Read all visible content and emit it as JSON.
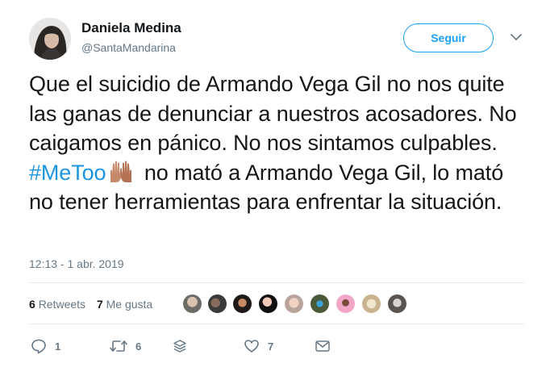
{
  "author": {
    "name": "Daniela Medina",
    "handle": "@SantaMandarina"
  },
  "follow_label": "Seguir",
  "tweet": {
    "part1": "Que el suicidio de Armando Vega Gil no nos quite las ganas de denunciar a nuestros acosadores. No caigamos en pánico. No nos sintamos culpables. ",
    "hashtag": "#MeToo",
    "emoji": "raised-hands-emoji",
    "part2": " no mató a Armando Vega Gil, lo mató no tener herramientas para enfrentar la situación."
  },
  "timestamp": "12:13 - 1 abr. 2019",
  "stats": {
    "retweets_count": "6",
    "retweets_label": "Retweets",
    "likes_count": "7",
    "likes_label": "Me gusta"
  },
  "likers_count": 9,
  "actions": {
    "reply_count": "1",
    "retweet_count": "6",
    "like_count": "7"
  },
  "icons": {
    "reply": "reply-icon",
    "retweet": "retweet-icon",
    "stack": "stack-icon",
    "like": "heart-icon",
    "message": "envelope-icon",
    "more": "chevron-down-icon"
  },
  "colors": {
    "accent": "#1da1f2",
    "hashtag": "#1b95e0",
    "secondary_text": "#657786",
    "primary_text": "#14171a"
  }
}
